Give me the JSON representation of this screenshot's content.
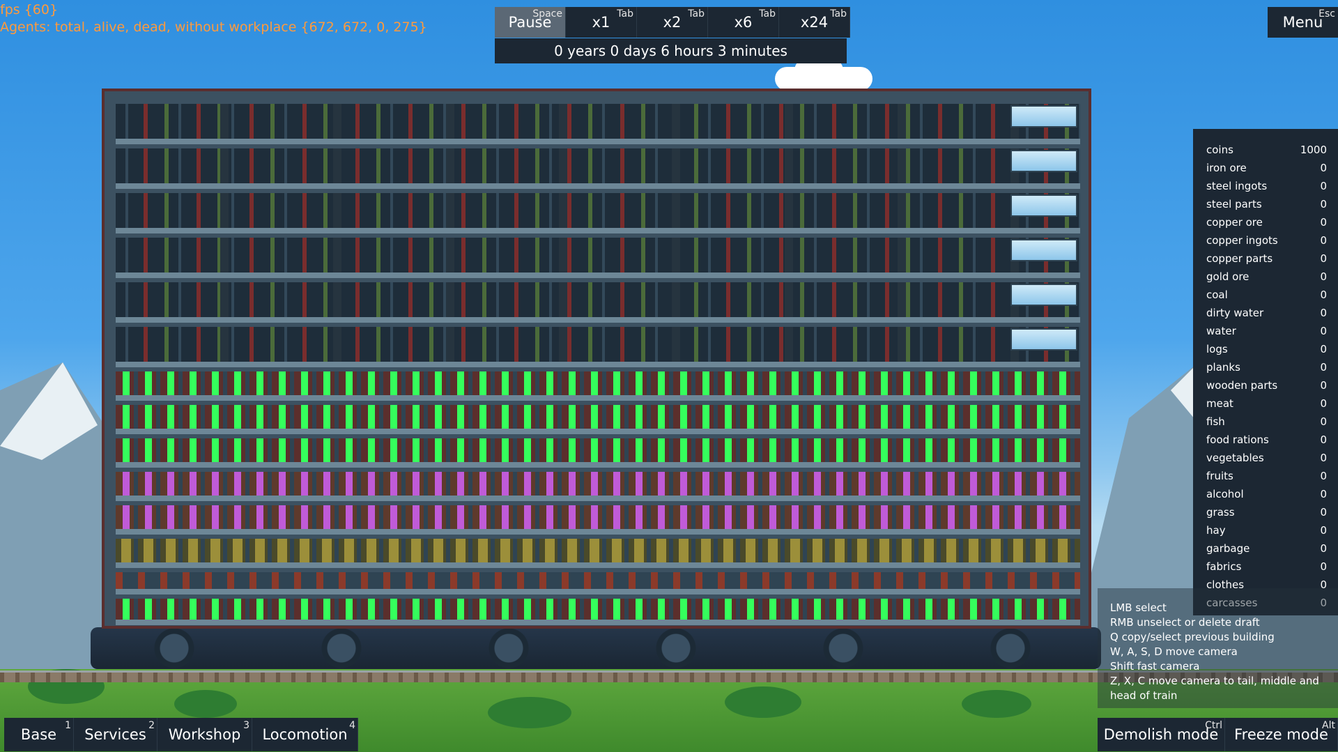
{
  "debug": {
    "fps": "fps {60}",
    "agents": "Agents: total, alive, dead, without workplace {672, 672, 0, 275}"
  },
  "speed_controls": [
    {
      "label": "Pause",
      "key": "Space",
      "active": true
    },
    {
      "label": "x1",
      "key": "Tab",
      "active": false
    },
    {
      "label": "x2",
      "key": "Tab",
      "active": false
    },
    {
      "label": "x6",
      "key": "Tab",
      "active": false
    },
    {
      "label": "x24",
      "key": "Tab",
      "active": false
    }
  ],
  "clock": "0 years 0 days 6 hours 3 minutes",
  "menu": {
    "label": "Menu",
    "key": "Esc"
  },
  "resources": [
    {
      "name": "coins",
      "value": "1000"
    },
    {
      "name": "iron ore",
      "value": "0"
    },
    {
      "name": "steel ingots",
      "value": "0"
    },
    {
      "name": "steel parts",
      "value": "0"
    },
    {
      "name": "copper ore",
      "value": "0"
    },
    {
      "name": "copper ingots",
      "value": "0"
    },
    {
      "name": "copper parts",
      "value": "0"
    },
    {
      "name": "gold ore",
      "value": "0"
    },
    {
      "name": "coal",
      "value": "0"
    },
    {
      "name": "dirty water",
      "value": "0"
    },
    {
      "name": "water",
      "value": "0"
    },
    {
      "name": "logs",
      "value": "0"
    },
    {
      "name": "planks",
      "value": "0"
    },
    {
      "name": "wooden parts",
      "value": "0"
    },
    {
      "name": "meat",
      "value": "0"
    },
    {
      "name": "fish",
      "value": "0"
    },
    {
      "name": "food rations",
      "value": "0"
    },
    {
      "name": "vegetables",
      "value": "0"
    },
    {
      "name": "fruits",
      "value": "0"
    },
    {
      "name": "alcohol",
      "value": "0"
    },
    {
      "name": "grass",
      "value": "0"
    },
    {
      "name": "hay",
      "value": "0"
    },
    {
      "name": "garbage",
      "value": "0"
    },
    {
      "name": "fabrics",
      "value": "0"
    },
    {
      "name": "clothes",
      "value": "0"
    },
    {
      "name": "carcasses",
      "value": "0"
    }
  ],
  "help_lines": [
    "LMB select",
    "RMB unselect or delete draft",
    "Q copy/select previous building",
    "W, A, S, D move camera",
    "Shift fast camera",
    "Z, X, C move camera to tail, middle and head of train"
  ],
  "build_tabs": [
    {
      "label": "Base",
      "key": "1"
    },
    {
      "label": "Services",
      "key": "2"
    },
    {
      "label": "Workshop",
      "key": "3"
    },
    {
      "label": "Locomotion",
      "key": "4"
    }
  ],
  "modes": [
    {
      "label": "Demolish mode",
      "key": "Ctrl"
    },
    {
      "label": "Freeze mode",
      "key": "Alt"
    }
  ]
}
